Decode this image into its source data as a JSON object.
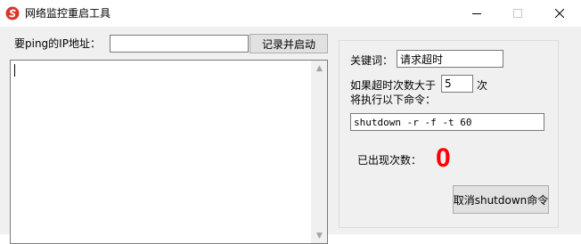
{
  "window": {
    "title": "网络监控重启工具",
    "icon": "app-logo-icon",
    "controls": [
      "minimize-icon",
      "maximize-icon",
      "close-icon"
    ]
  },
  "monitor": {
    "ip_label": "要ping的IP地址：",
    "ip_value": "",
    "start_button": "记录并启动",
    "log_text": ""
  },
  "settings": {
    "keyword_label": "关键词：",
    "keyword_value": "请求超时",
    "threshold_label_prefix": "如果超时次数大于",
    "threshold_value": "5",
    "threshold_unit": "次",
    "command_label": "将执行以下命令：",
    "command_value": "shutdown -r -f -t 60",
    "count_label": "已出现次数：",
    "count_value": "0",
    "cancel_button": "取消shutdown命令"
  },
  "colors": {
    "count": "#ff0000",
    "logo": "#d9362b"
  }
}
